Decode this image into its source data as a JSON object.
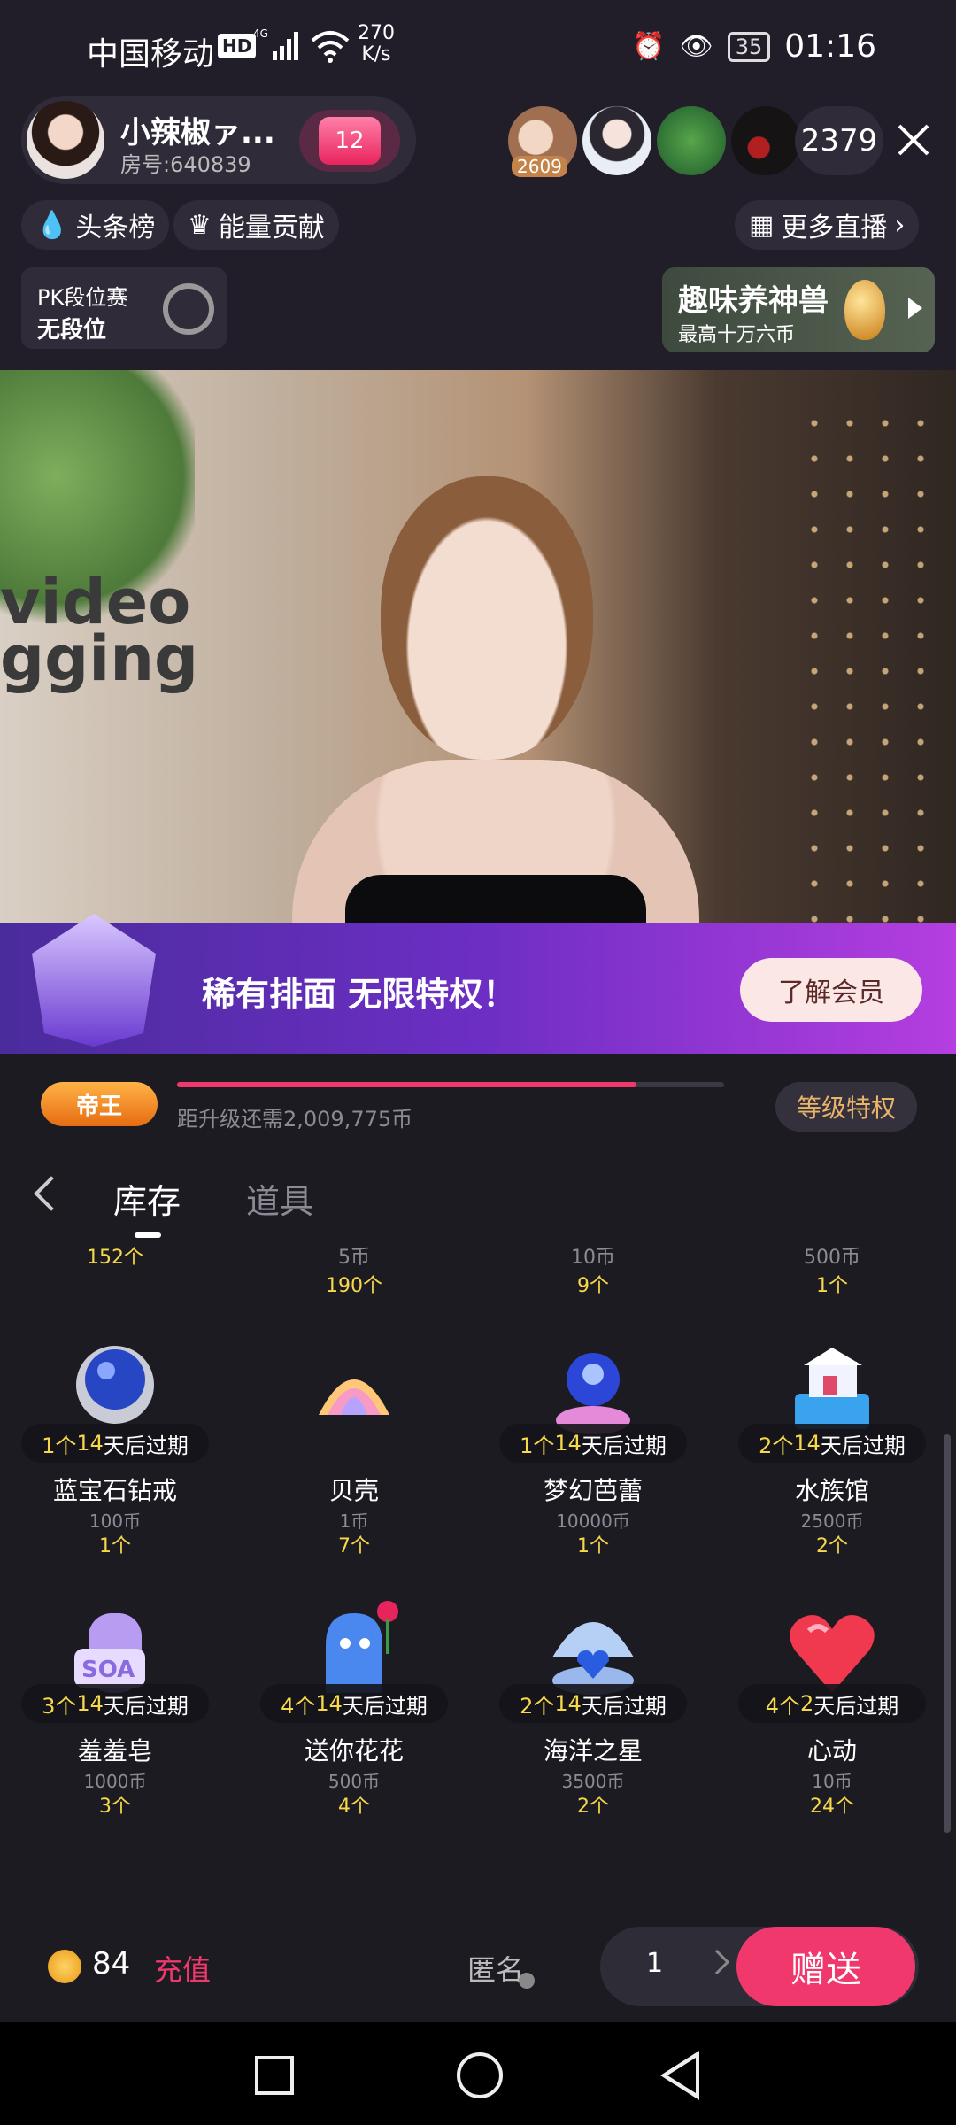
{
  "status": {
    "carrier": "中国移动",
    "hd": "HD",
    "net": "4G",
    "speed": "270\nK/s",
    "battery": "35",
    "time": "01:16"
  },
  "anchor": {
    "name": "小辣椒ァ...",
    "room": "房号:640839",
    "heart_level": "12"
  },
  "viewers": {
    "top_badge": "2609",
    "count": "2379"
  },
  "chips": {
    "headline": "头条榜",
    "energy": "能量贡献",
    "more_live": "更多直播"
  },
  "pk": {
    "title": "PK段位赛",
    "rank": "无段位"
  },
  "fun": {
    "title": "趣味养神兽",
    "subtitle": "最高十万六币"
  },
  "banner": {
    "text": "稀有排面  无限特权！",
    "button": "了解会员"
  },
  "level": {
    "badge": "帝王",
    "progress": 0.84,
    "text": "距升级还需2,009,775币",
    "button": "等级特权"
  },
  "tabs": {
    "inventory": "库存",
    "props": "道具"
  },
  "top_row": [
    {
      "price": "",
      "qty": "152个"
    },
    {
      "price": "5币",
      "qty": "190个"
    },
    {
      "price": "10币",
      "qty": "9个"
    },
    {
      "price": "500币",
      "qty": "1个"
    }
  ],
  "gifts": [
    {
      "count": "1个",
      "days": "14",
      "suffix": "天后过期",
      "name": "蓝宝石钻戒",
      "price": "100币",
      "qty": "1个",
      "icon": "sapphire-ring-icon"
    },
    {
      "count": "",
      "days": "",
      "suffix": "",
      "name": "贝壳",
      "price": "1币",
      "qty": "7个",
      "icon": "shell-icon"
    },
    {
      "count": "1个",
      "days": "14",
      "suffix": "天后过期",
      "name": "梦幻芭蕾",
      "price": "10000币",
      "qty": "1个",
      "icon": "ballet-icon"
    },
    {
      "count": "2个",
      "days": "14",
      "suffix": "天后过期",
      "name": "水族馆",
      "price": "2500币",
      "qty": "2个",
      "icon": "aquarium-icon"
    },
    {
      "count": "3个",
      "days": "14",
      "suffix": "天后过期",
      "name": "羞羞皂",
      "price": "1000币",
      "qty": "3个",
      "icon": "soap-icon"
    },
    {
      "count": "4个",
      "days": "14",
      "suffix": "天后过期",
      "name": "送你花花",
      "price": "500币",
      "qty": "4个",
      "icon": "ghost-rose-icon"
    },
    {
      "count": "2个",
      "days": "14",
      "suffix": "天后过期",
      "name": "海洋之星",
      "price": "3500币",
      "qty": "2个",
      "icon": "ocean-star-icon"
    },
    {
      "count": "4个",
      "days": "2",
      "suffix": "天后过期",
      "name": "心动",
      "price": "10币",
      "qty": "24个",
      "icon": "heart-icon"
    }
  ],
  "bottom": {
    "balance": "84",
    "recharge": "充值",
    "anonymous": "匿名",
    "quantity": "1",
    "send": "赠送"
  }
}
